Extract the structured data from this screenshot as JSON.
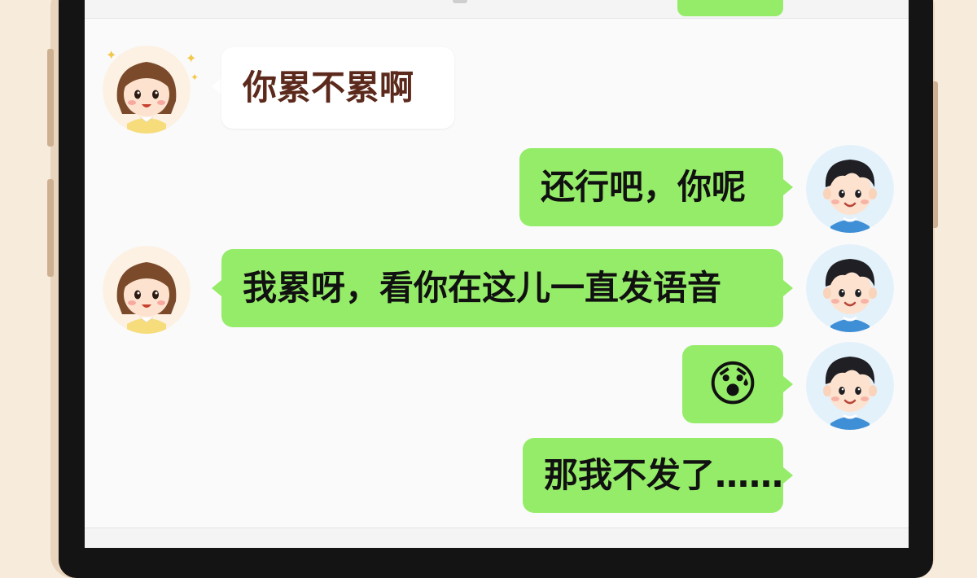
{
  "chat": {
    "messages": [
      {
        "side": "left",
        "type": "text",
        "text": "你累不累啊"
      },
      {
        "side": "right",
        "type": "text",
        "text": "还行吧，你呢"
      },
      {
        "side": "left",
        "type": "text",
        "text": "我累呀，看你在这儿一直发语音"
      },
      {
        "side": "right",
        "type": "emoji",
        "emoji": "😰"
      },
      {
        "side": "right",
        "type": "text",
        "text": "那我不发了……"
      }
    ]
  },
  "colors": {
    "outgoing_bubble": "#95ec69",
    "incoming_bubble": "#ffffff",
    "incoming_text": "#5c2a1c",
    "chat_background": "#fafafa",
    "phone_frame": "#e9d4bd"
  },
  "icons": {
    "girl_avatar": "girl-avatar",
    "boy_avatar": "boy-avatar"
  }
}
